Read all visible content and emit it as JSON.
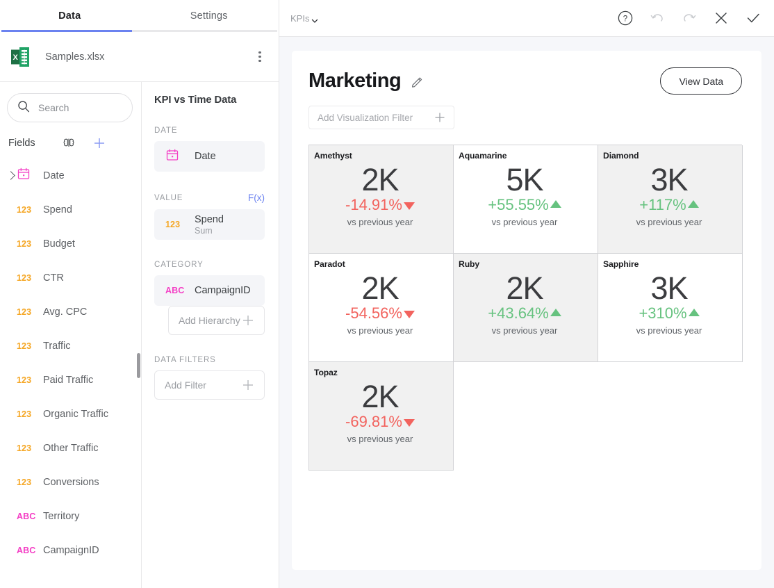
{
  "left_panel": {
    "tabs": [
      {
        "label": "Data",
        "active": true
      },
      {
        "label": "Settings",
        "active": false
      }
    ],
    "file": {
      "name": "Samples.xlsx",
      "icon": "excel-file-icon",
      "menu_icon": "kebab-menu-icon"
    },
    "search": {
      "placeholder": "Search",
      "icon": "search-icon"
    },
    "fields_header": {
      "label": "Fields",
      "ai_icon": "brain-icon",
      "add_icon": "plus-icon"
    },
    "fields": [
      {
        "name": "Date",
        "type": "date",
        "expandable": true
      },
      {
        "name": "Spend",
        "type": "123"
      },
      {
        "name": "Budget",
        "type": "123"
      },
      {
        "name": "CTR",
        "type": "123"
      },
      {
        "name": "Avg. CPC",
        "type": "123"
      },
      {
        "name": "Traffic",
        "type": "123"
      },
      {
        "name": "Paid Traffic",
        "type": "123"
      },
      {
        "name": "Organic Traffic",
        "type": "123"
      },
      {
        "name": "Other Traffic",
        "type": "123"
      },
      {
        "name": "Conversions",
        "type": "123"
      },
      {
        "name": "Territory",
        "type": "ABC"
      },
      {
        "name": "CampaignID",
        "type": "ABC"
      }
    ]
  },
  "config": {
    "title": "KPI vs Time Data",
    "date_section": {
      "label": "DATE",
      "field": "Date",
      "type": "date"
    },
    "value_section": {
      "label": "VALUE",
      "fx_label": "F(x)",
      "field": "Spend",
      "aggregation": "Sum",
      "type": "123"
    },
    "category_section": {
      "label": "CATEGORY",
      "field": "CampaignID",
      "type": "ABC",
      "add_hierarchy_label": "Add Hierarchy"
    },
    "filters_section": {
      "label": "DATA FILTERS",
      "add_filter_label": "Add Filter"
    }
  },
  "topbar": {
    "chart_type": "KPIs",
    "icons": [
      {
        "name": "help-icon",
        "enabled": true
      },
      {
        "name": "undo-icon",
        "enabled": false
      },
      {
        "name": "redo-icon",
        "enabled": false
      },
      {
        "name": "close-icon",
        "enabled": true
      },
      {
        "name": "confirm-check-icon",
        "enabled": true
      }
    ]
  },
  "canvas": {
    "title": "Marketing",
    "edit_icon": "pencil-icon",
    "view_data_label": "View Data",
    "visualization_filter_placeholder": "Add Visualization Filter"
  },
  "chart_data": {
    "type": "table",
    "title": "Marketing",
    "value_field": "Spend (Sum)",
    "category_field": "CampaignID",
    "comparison_caption": "vs previous year",
    "categories": [
      "Amethyst",
      "Aquamarine",
      "Diamond",
      "Paradot",
      "Ruby",
      "Sapphire",
      "Topaz"
    ],
    "values": [
      "2K",
      "5K",
      "3K",
      "2K",
      "2K",
      "3K",
      "2K"
    ],
    "deltas": [
      "-14.91%",
      "+55.55%",
      "+117%",
      "-54.56%",
      "+43.64%",
      "+310%",
      "-69.81%"
    ],
    "delta_numeric": [
      -14.91,
      55.55,
      117,
      -54.56,
      43.64,
      310,
      -69.81
    ],
    "cards": [
      {
        "name": "Amethyst",
        "value": "2K",
        "delta": "-14.91%",
        "direction": "down",
        "caption": "vs previous year",
        "shaded": true
      },
      {
        "name": "Aquamarine",
        "value": "5K",
        "delta": "+55.55%",
        "direction": "up",
        "caption": "vs previous year",
        "shaded": false
      },
      {
        "name": "Diamond",
        "value": "3K",
        "delta": "+117%",
        "direction": "up",
        "caption": "vs previous year",
        "shaded": true
      },
      {
        "name": "Paradot",
        "value": "2K",
        "delta": "-54.56%",
        "direction": "down",
        "caption": "vs previous year",
        "shaded": false
      },
      {
        "name": "Ruby",
        "value": "2K",
        "delta": "+43.64%",
        "direction": "up",
        "caption": "vs previous year",
        "shaded": true
      },
      {
        "name": "Sapphire",
        "value": "3K",
        "delta": "+310%",
        "direction": "up",
        "caption": "vs previous year",
        "shaded": false
      },
      {
        "name": "Topaz",
        "value": "2K",
        "delta": "-69.81%",
        "direction": "down",
        "caption": "vs previous year",
        "shaded": true
      }
    ],
    "colors": {
      "positive": "#66c27f",
      "negative": "#f2635e",
      "value": "#3b3c3f",
      "accent": "#6b82f0"
    }
  }
}
